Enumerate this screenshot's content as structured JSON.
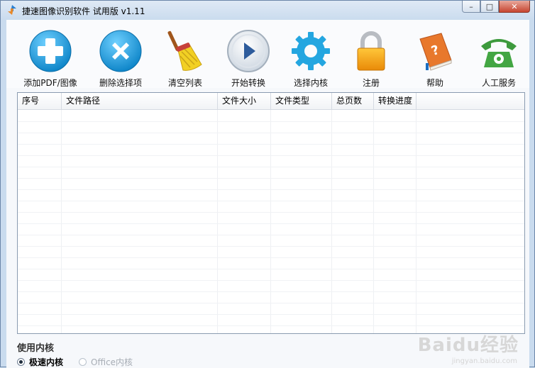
{
  "window": {
    "title": "捷速图像识别软件 试用版 v1.11",
    "buttons": {
      "minimize": "–",
      "maximize": "□",
      "close": "✕"
    }
  },
  "toolbar": [
    {
      "name": "add-pdf-image",
      "label": "添加PDF/图像",
      "icon": "plus-icon"
    },
    {
      "name": "delete-selected",
      "label": "删除选择项",
      "icon": "x-icon"
    },
    {
      "name": "clear-list",
      "label": "清空列表",
      "icon": "broom-icon"
    },
    {
      "name": "start-convert",
      "label": "开始转换",
      "icon": "play-icon"
    },
    {
      "name": "select-kernel",
      "label": "选择内核",
      "icon": "gear-icon"
    },
    {
      "name": "register",
      "label": "注册",
      "icon": "lock-icon"
    },
    {
      "name": "help",
      "label": "帮助",
      "icon": "book-icon"
    },
    {
      "name": "manual-service",
      "label": "人工服务",
      "icon": "phone-icon"
    }
  ],
  "table": {
    "columns": [
      "序号",
      "文件路径",
      "文件大小",
      "文件类型",
      "总页数",
      "转换进度"
    ],
    "rows": []
  },
  "kernel": {
    "title": "使用内核",
    "options": [
      {
        "label": "极速内核",
        "selected": true,
        "enabled": true
      },
      {
        "label": "Office内核",
        "selected": false,
        "enabled": false
      }
    ]
  },
  "watermark": {
    "text": "Baidu经验",
    "sub": "jingyan.baidu.com"
  },
  "colors": {
    "accent": "#1a9ad6",
    "title_bg": "#c9dbee"
  }
}
